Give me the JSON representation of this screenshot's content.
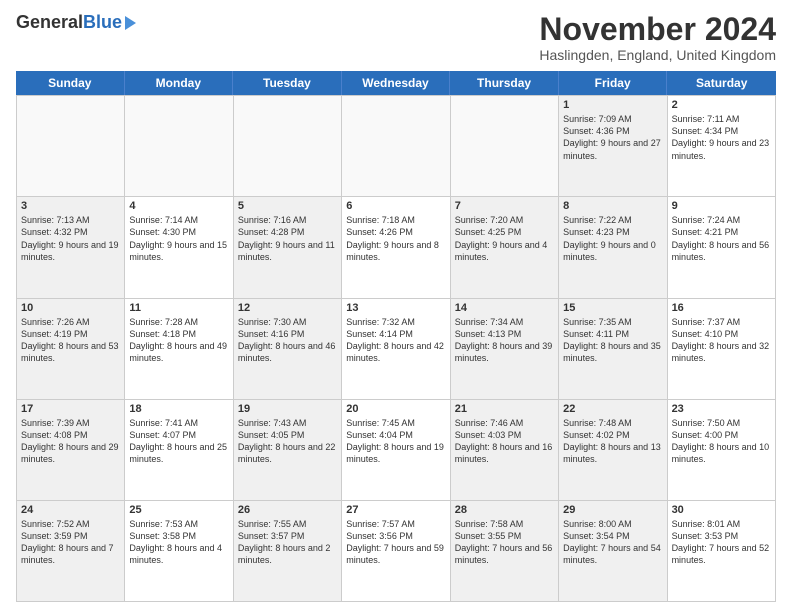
{
  "header": {
    "logo_general": "General",
    "logo_blue": "Blue",
    "month_title": "November 2024",
    "location": "Haslingden, England, United Kingdom"
  },
  "days_of_week": [
    "Sunday",
    "Monday",
    "Tuesday",
    "Wednesday",
    "Thursday",
    "Friday",
    "Saturday"
  ],
  "weeks": [
    [
      {
        "day": "",
        "info": "",
        "empty": true
      },
      {
        "day": "",
        "info": "",
        "empty": true
      },
      {
        "day": "",
        "info": "",
        "empty": true
      },
      {
        "day": "",
        "info": "",
        "empty": true
      },
      {
        "day": "",
        "info": "",
        "empty": true
      },
      {
        "day": "1",
        "info": "Sunrise: 7:09 AM\nSunset: 4:36 PM\nDaylight: 9 hours and 27 minutes.",
        "shaded": true
      },
      {
        "day": "2",
        "info": "Sunrise: 7:11 AM\nSunset: 4:34 PM\nDaylight: 9 hours and 23 minutes.",
        "shaded": false
      }
    ],
    [
      {
        "day": "3",
        "info": "Sunrise: 7:13 AM\nSunset: 4:32 PM\nDaylight: 9 hours and 19 minutes.",
        "shaded": true
      },
      {
        "day": "4",
        "info": "Sunrise: 7:14 AM\nSunset: 4:30 PM\nDaylight: 9 hours and 15 minutes.",
        "shaded": false
      },
      {
        "day": "5",
        "info": "Sunrise: 7:16 AM\nSunset: 4:28 PM\nDaylight: 9 hours and 11 minutes.",
        "shaded": true
      },
      {
        "day": "6",
        "info": "Sunrise: 7:18 AM\nSunset: 4:26 PM\nDaylight: 9 hours and 8 minutes.",
        "shaded": false
      },
      {
        "day": "7",
        "info": "Sunrise: 7:20 AM\nSunset: 4:25 PM\nDaylight: 9 hours and 4 minutes.",
        "shaded": true
      },
      {
        "day": "8",
        "info": "Sunrise: 7:22 AM\nSunset: 4:23 PM\nDaylight: 9 hours and 0 minutes.",
        "shaded": true
      },
      {
        "day": "9",
        "info": "Sunrise: 7:24 AM\nSunset: 4:21 PM\nDaylight: 8 hours and 56 minutes.",
        "shaded": false
      }
    ],
    [
      {
        "day": "10",
        "info": "Sunrise: 7:26 AM\nSunset: 4:19 PM\nDaylight: 8 hours and 53 minutes.",
        "shaded": true
      },
      {
        "day": "11",
        "info": "Sunrise: 7:28 AM\nSunset: 4:18 PM\nDaylight: 8 hours and 49 minutes.",
        "shaded": false
      },
      {
        "day": "12",
        "info": "Sunrise: 7:30 AM\nSunset: 4:16 PM\nDaylight: 8 hours and 46 minutes.",
        "shaded": true
      },
      {
        "day": "13",
        "info": "Sunrise: 7:32 AM\nSunset: 4:14 PM\nDaylight: 8 hours and 42 minutes.",
        "shaded": false
      },
      {
        "day": "14",
        "info": "Sunrise: 7:34 AM\nSunset: 4:13 PM\nDaylight: 8 hours and 39 minutes.",
        "shaded": true
      },
      {
        "day": "15",
        "info": "Sunrise: 7:35 AM\nSunset: 4:11 PM\nDaylight: 8 hours and 35 minutes.",
        "shaded": true
      },
      {
        "day": "16",
        "info": "Sunrise: 7:37 AM\nSunset: 4:10 PM\nDaylight: 8 hours and 32 minutes.",
        "shaded": false
      }
    ],
    [
      {
        "day": "17",
        "info": "Sunrise: 7:39 AM\nSunset: 4:08 PM\nDaylight: 8 hours and 29 minutes.",
        "shaded": true
      },
      {
        "day": "18",
        "info": "Sunrise: 7:41 AM\nSunset: 4:07 PM\nDaylight: 8 hours and 25 minutes.",
        "shaded": false
      },
      {
        "day": "19",
        "info": "Sunrise: 7:43 AM\nSunset: 4:05 PM\nDaylight: 8 hours and 22 minutes.",
        "shaded": true
      },
      {
        "day": "20",
        "info": "Sunrise: 7:45 AM\nSunset: 4:04 PM\nDaylight: 8 hours and 19 minutes.",
        "shaded": false
      },
      {
        "day": "21",
        "info": "Sunrise: 7:46 AM\nSunset: 4:03 PM\nDaylight: 8 hours and 16 minutes.",
        "shaded": true
      },
      {
        "day": "22",
        "info": "Sunrise: 7:48 AM\nSunset: 4:02 PM\nDaylight: 8 hours and 13 minutes.",
        "shaded": true
      },
      {
        "day": "23",
        "info": "Sunrise: 7:50 AM\nSunset: 4:00 PM\nDaylight: 8 hours and 10 minutes.",
        "shaded": false
      }
    ],
    [
      {
        "day": "24",
        "info": "Sunrise: 7:52 AM\nSunset: 3:59 PM\nDaylight: 8 hours and 7 minutes.",
        "shaded": true
      },
      {
        "day": "25",
        "info": "Sunrise: 7:53 AM\nSunset: 3:58 PM\nDaylight: 8 hours and 4 minutes.",
        "shaded": false
      },
      {
        "day": "26",
        "info": "Sunrise: 7:55 AM\nSunset: 3:57 PM\nDaylight: 8 hours and 2 minutes.",
        "shaded": true
      },
      {
        "day": "27",
        "info": "Sunrise: 7:57 AM\nSunset: 3:56 PM\nDaylight: 7 hours and 59 minutes.",
        "shaded": false
      },
      {
        "day": "28",
        "info": "Sunrise: 7:58 AM\nSunset: 3:55 PM\nDaylight: 7 hours and 56 minutes.",
        "shaded": true
      },
      {
        "day": "29",
        "info": "Sunrise: 8:00 AM\nSunset: 3:54 PM\nDaylight: 7 hours and 54 minutes.",
        "shaded": true
      },
      {
        "day": "30",
        "info": "Sunrise: 8:01 AM\nSunset: 3:53 PM\nDaylight: 7 hours and 52 minutes.",
        "shaded": false
      }
    ]
  ]
}
